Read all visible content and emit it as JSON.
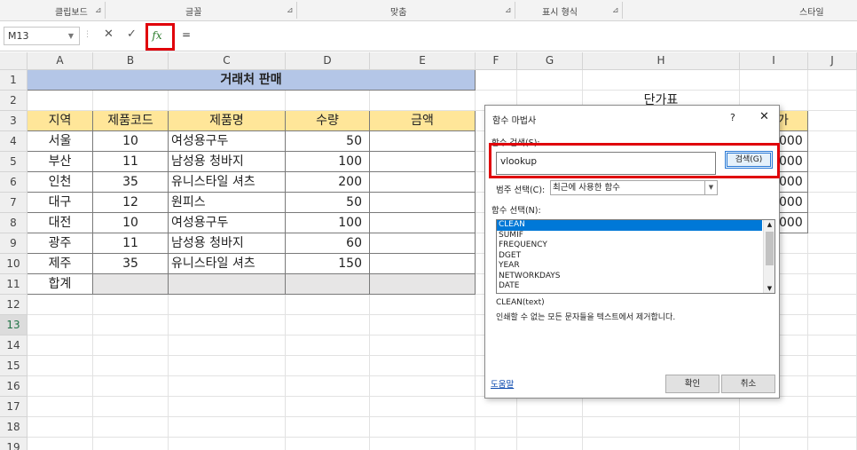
{
  "ribbon": {
    "groups": [
      "클립보드",
      "글꼴",
      "맞춤",
      "표시 형식",
      "스타일"
    ]
  },
  "formula_bar": {
    "name_box": "M13",
    "cancel_icon": "✕",
    "enter_icon": "✓",
    "fx_label": "fx",
    "formula": "="
  },
  "columns": [
    "A",
    "B",
    "C",
    "D",
    "E",
    "F",
    "G",
    "H",
    "I",
    "J"
  ],
  "rows": [
    "1",
    "2",
    "3",
    "4",
    "5",
    "6",
    "7",
    "8",
    "9",
    "10",
    "11",
    "12",
    "13",
    "14",
    "15",
    "16",
    "17",
    "18",
    "19"
  ],
  "sheet": {
    "title": "거래처 판매",
    "headers": [
      "지역",
      "제품코드",
      "제품명",
      "수량",
      "금액"
    ],
    "data": [
      [
        "서울",
        "10",
        "여성용구두",
        "50",
        ""
      ],
      [
        "부산",
        "11",
        "남성용 청바지",
        "100",
        ""
      ],
      [
        "인천",
        "35",
        "유니스타일 셔츠",
        "200",
        ""
      ],
      [
        "대구",
        "12",
        "원피스",
        "50",
        ""
      ],
      [
        "대전",
        "10",
        "여성용구두",
        "100",
        ""
      ],
      [
        "광주",
        "11",
        "남성용 청바지",
        "60",
        ""
      ],
      [
        "제주",
        "35",
        "유니스타일 셔츠",
        "150",
        ""
      ]
    ],
    "total_label": "합계",
    "price_table_title": "단가표",
    "price_header_partial": "가",
    "price_values_partial": [
      "000",
      "000",
      "000",
      "000",
      "000"
    ]
  },
  "dialog": {
    "title": "함수 마법사",
    "help": "?",
    "close": "✕",
    "search_label": "함수 검색(S):",
    "search_value": "vlookup",
    "search_button": "검색(G)",
    "category_label": "범주 선택(C):",
    "category_value": "최근에 사용한 함수",
    "function_label": "함수 선택(N):",
    "functions": [
      "CLEAN",
      "SUMIF",
      "FREQUENCY",
      "DGET",
      "YEAR",
      "NETWORKDAYS",
      "DATE"
    ],
    "syntax": "CLEAN(text)",
    "description": "인쇄할 수 없는 모든 문자들을 텍스트에서 제거합니다.",
    "help_link": "도움말",
    "ok": "확인",
    "cancel": "취소"
  },
  "colors": {
    "title_fill": "#b4c6e7",
    "header_fill": "#ffe699",
    "total_fill": "#e7e6e6",
    "highlight": "#e0000a",
    "selection": "#0078d7"
  }
}
